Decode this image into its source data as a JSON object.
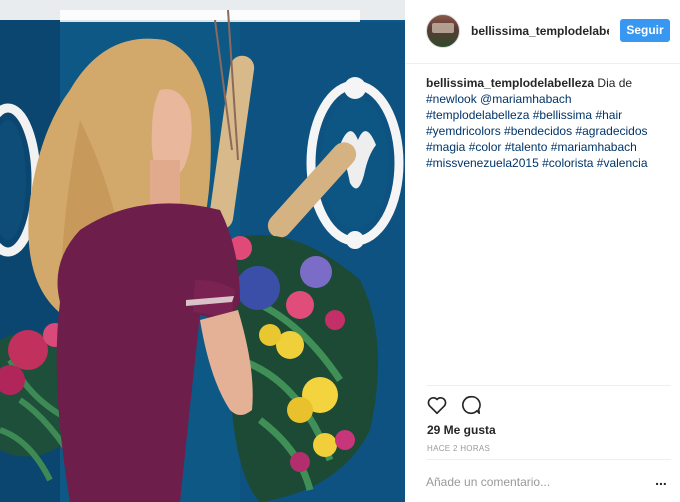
{
  "post": {
    "photo_alt": "Woman with long blonde hair wearing a purple polo shirt next to a floral arrangement",
    "username": "bellissima_templodelabelleza",
    "follow_label": "Seguir",
    "caption": {
      "user": "bellissima_templodelabelleza",
      "lines": [
        {
          "pre": " Dia de",
          "tags": []
        },
        {
          "tags": [
            "#newlook",
            "@mariamhabach"
          ]
        },
        {
          "tags": [
            "#templodelabelleza",
            "#bellissima",
            "#hair"
          ]
        },
        {
          "tags": [
            "#yemdricolors",
            "#bendecidos",
            "#agradecidos"
          ]
        },
        {
          "tags": [
            "#magia",
            "#color",
            "#talento",
            "#mariamhabach"
          ]
        },
        {
          "tags": [
            "#missvenezuela2015",
            "#colorista",
            "#valencia"
          ]
        }
      ]
    },
    "icons": {
      "like": "heart-icon",
      "comment": "comment-bubble-icon",
      "more": "more-options-icon"
    },
    "likes_text": "29 Me gusta",
    "timestamp": "HACE 2 HORAS",
    "comment_placeholder": "Añade un comentario...",
    "more_label": "...",
    "colors": {
      "follow_button": "#3897f0",
      "hashtag": "#003569",
      "wall_blue": "#0f5a87"
    }
  }
}
